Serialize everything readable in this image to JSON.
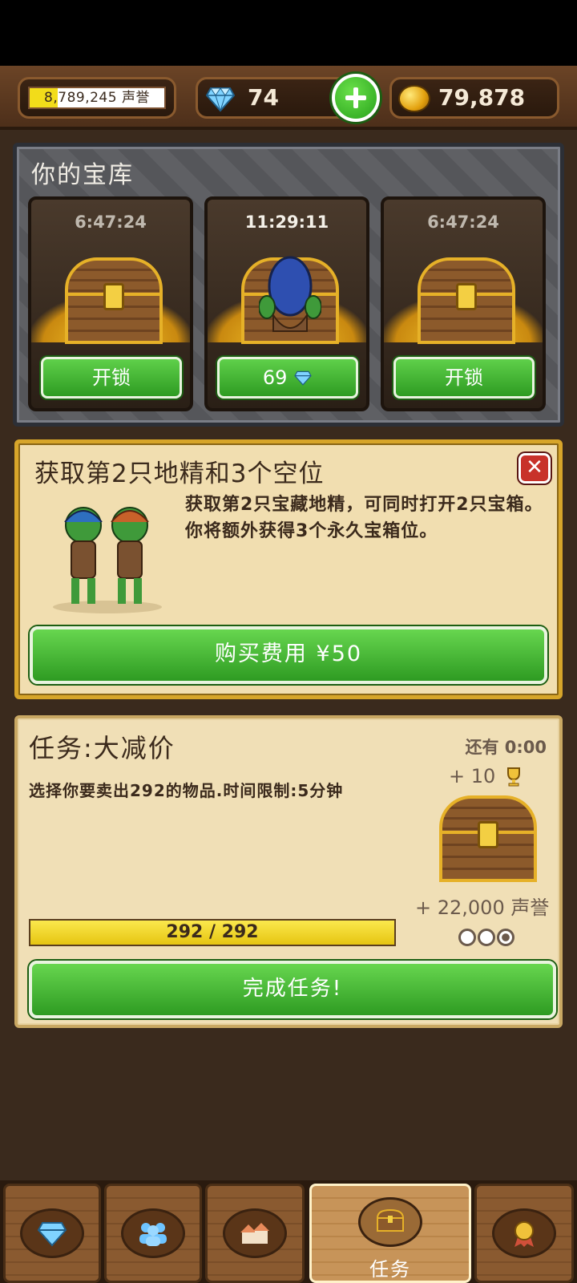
{
  "header": {
    "reputation_text": "8,789,245 声誉",
    "gems": "74",
    "gold": "79,878"
  },
  "vault": {
    "title": "你的宝库",
    "slots": [
      {
        "timer": "6:47:24",
        "button": "开锁"
      },
      {
        "timer": "11:29:11",
        "button_value": "69"
      },
      {
        "timer": "6:47:24",
        "button": "开锁"
      }
    ]
  },
  "offer": {
    "title": "获取第2只地精和3个空位",
    "description": "获取第2只宝藏地精，可同时打开2只宝箱。你将额外获得3个永久宝箱位。",
    "buy_button": "购买费用 ¥50"
  },
  "quest": {
    "title": "任务:大减价",
    "remaining": "还有 0:00",
    "description": "选择你要卖出292的物品.时间限制:5分钟",
    "trophy_reward": "+ 10",
    "reputation_reward": "+ 22,000 声誉",
    "progress_text": "292 / 292",
    "progress_fraction": 1.0,
    "complete_button": "完成任务!"
  },
  "bottom_nav": {
    "tabs": [
      {
        "icon": "gem-icon"
      },
      {
        "icon": "people-icon"
      },
      {
        "icon": "houses-icon"
      },
      {
        "icon": "chest-icon",
        "label": "任务"
      },
      {
        "icon": "medal-icon"
      }
    ]
  },
  "colors": {
    "green_button": "#2e9b22",
    "gold_accent": "#d7a52a",
    "brown_bg": "#3a2a1d"
  }
}
